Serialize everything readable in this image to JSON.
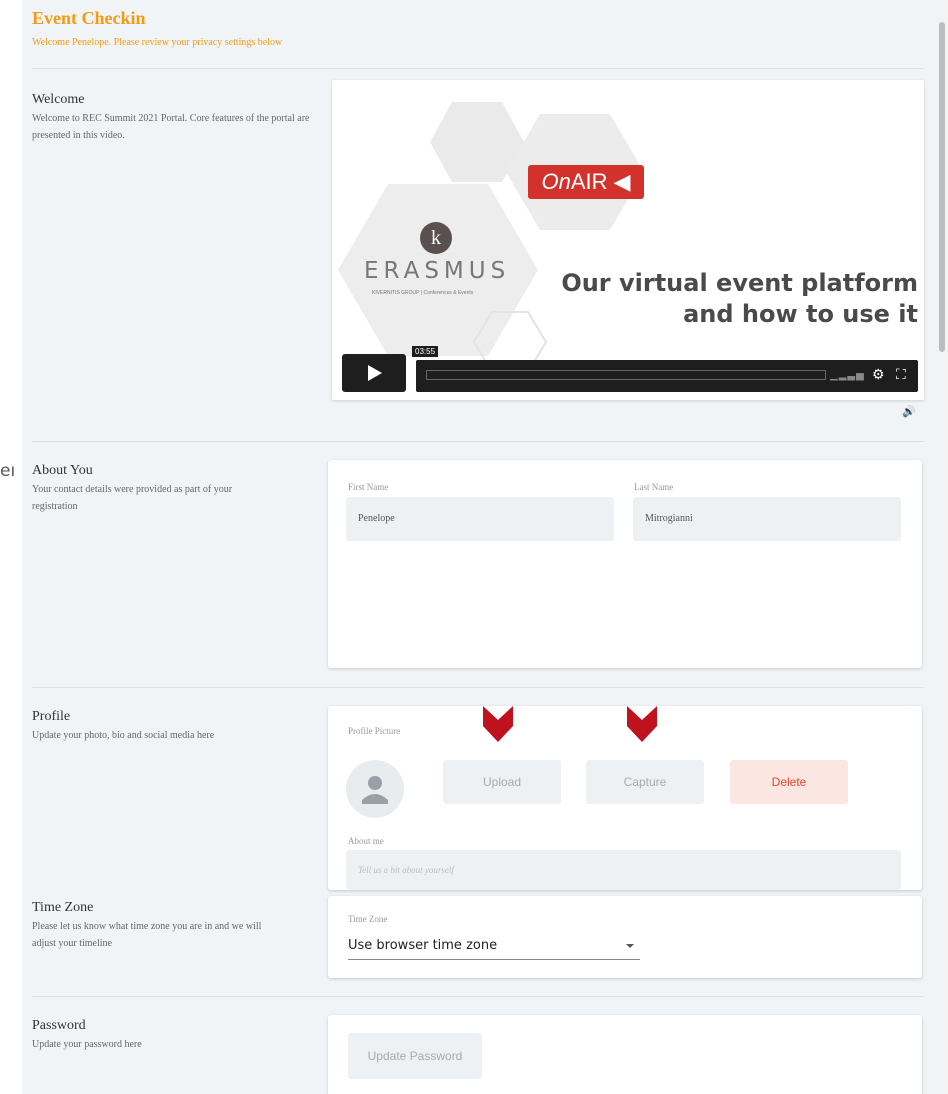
{
  "stray_text": "eı",
  "header": {
    "title": "Event Checkin",
    "subtitle": "Welcome Penelope. Please review your privacy settings below"
  },
  "welcome": {
    "title": "Welcome",
    "description": "Welcome to REC Summit 2021 Portal. Core features of the portal are presented in this video.",
    "video": {
      "brand_on": "On",
      "brand_air": "AIR",
      "logo_letter": "k",
      "org_name": "ERASMUS",
      "org_tagline": "KIVERNITIS GROUP | Conferences & Events",
      "headline_line1": "Our virtual event platform",
      "headline_line2": "and how to use it",
      "duration": "03:55"
    }
  },
  "about": {
    "title": "About You",
    "description": "Your contact details were provided as part of your registration",
    "first_name_label": "First Name",
    "first_name_value": "Penelope",
    "last_name_label": "Last Name",
    "last_name_value": "Mitrogianni"
  },
  "profile": {
    "title": "Profile",
    "description": "Update your photo, bio and social media here",
    "picture_label": "Profile Picture",
    "upload_label": "Upload",
    "capture_label": "Capture",
    "delete_label": "Delete",
    "about_label": "About me",
    "about_placeholder": "Tell us a bit about yourself"
  },
  "timezone": {
    "title": "Time Zone",
    "description": "Please let us know what time zone you are in and we will adjust your timeline",
    "field_label": "Time Zone",
    "selected": "Use browser time zone"
  },
  "password": {
    "title": "Password",
    "description": "Update your password here",
    "button_label": "Update Password"
  },
  "colors": {
    "accent": "#f39c12",
    "danger": "#e8452c",
    "arrow": "#c0111f",
    "onair_red": "#d3312b"
  }
}
